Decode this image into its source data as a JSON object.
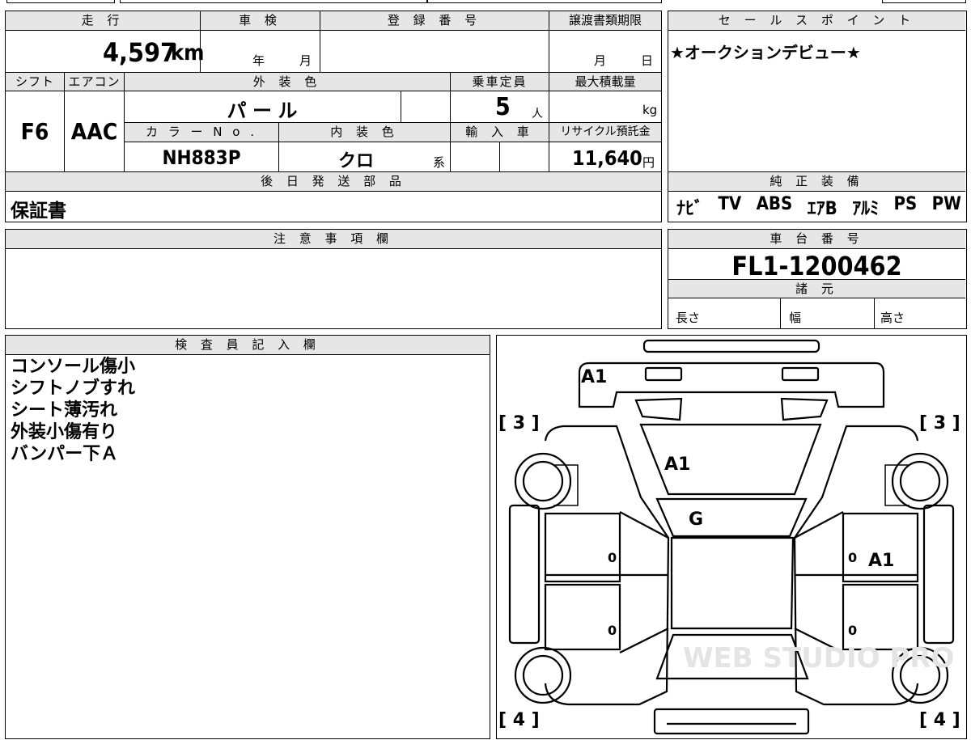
{
  "vehicle": {
    "mileage_label": "走 行",
    "mileage_value": "4,597",
    "mileage_unit": "km",
    "inspection_label": "車 検",
    "year_unit": "年",
    "month_unit": "月",
    "registration_label": "登 録 番 号",
    "transfer_deadline_label": "譲渡書類期限",
    "day_unit": "日",
    "shift_label": "シフト",
    "shift_value": "F6",
    "ac_label": "エアコン",
    "ac_value": "AAC",
    "exterior_color_label": "外 装 色",
    "exterior_color_value": "パ ー ル",
    "capacity_label": "乗車定員",
    "capacity_value": "5",
    "capacity_unit": "人",
    "max_load_label": "最大積載量",
    "max_load_unit": "kg",
    "color_no_label": "カ ラ ー N o .",
    "color_no_value": "NH883P",
    "interior_color_label": "内 装 色",
    "interior_color_value": "クロ",
    "interior_suffix": "系",
    "import_label": "輸 入 車",
    "recycle_label": "リサイクル預託金",
    "recycle_value": "11,640",
    "recycle_unit": "円"
  },
  "parts": {
    "label": "後 日 発 送 部 品",
    "value": "保証書"
  },
  "sales_point": {
    "label": "セ ー ル ス ポ イ ン ト",
    "value": "★オークションデビュー★"
  },
  "equipment": {
    "label": "純 正 装 備",
    "items": [
      "ﾅﾋﾞ",
      "TV",
      "ABS",
      "ｴｱB",
      "ｱﾙﾐ",
      "PS",
      "PW"
    ]
  },
  "notes": {
    "label": "注 意 事 項 欄"
  },
  "chassis": {
    "label": "車 台 番 号",
    "value": "FL1-1200462",
    "specs_label": "諸 元",
    "length_label": "長さ",
    "width_label": "幅",
    "height_label": "高さ"
  },
  "inspector": {
    "label": "検 査 員 記 入 欄",
    "remarks": [
      "コンソール傷小",
      "シフトノブすれ",
      "シート薄汚れ",
      "外装小傷有り",
      "バンパー下Ａ"
    ]
  },
  "diagram": {
    "marks": [
      "A1",
      "A1",
      "G",
      "A1"
    ],
    "tire_front_left": "[ 3 ]",
    "tire_front_right": "[ 3 ]",
    "tire_rear_left": "[ 4 ]",
    "tire_rear_right": "[ 4 ]",
    "zeros": [
      "0",
      "0",
      "0",
      "0"
    ],
    "watermark": "WEB STUDIO PRO"
  }
}
